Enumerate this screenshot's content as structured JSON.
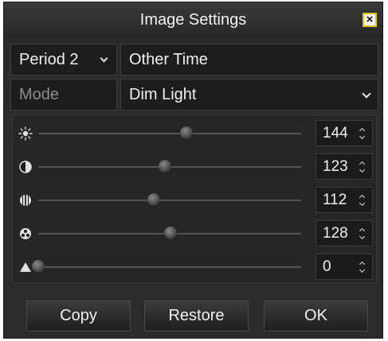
{
  "dialog": {
    "title": "Image Settings",
    "close_label": "×"
  },
  "period": {
    "selected": "Period 2",
    "time_value": "Other Time"
  },
  "mode": {
    "label": "Mode",
    "value": "Dim Light"
  },
  "sliders": [
    {
      "icon": "brightness-icon",
      "value": "144",
      "level": 0.564
    },
    {
      "icon": "contrast-icon",
      "value": "123",
      "level": 0.482
    },
    {
      "icon": "saturation-icon",
      "value": "112",
      "level": 0.439
    },
    {
      "icon": "hue-icon",
      "value": "128",
      "level": 0.502
    },
    {
      "icon": "sharpness-icon",
      "value": "0",
      "level": 0.0
    }
  ],
  "buttons": {
    "copy": "Copy",
    "restore": "Restore",
    "ok": "OK"
  }
}
